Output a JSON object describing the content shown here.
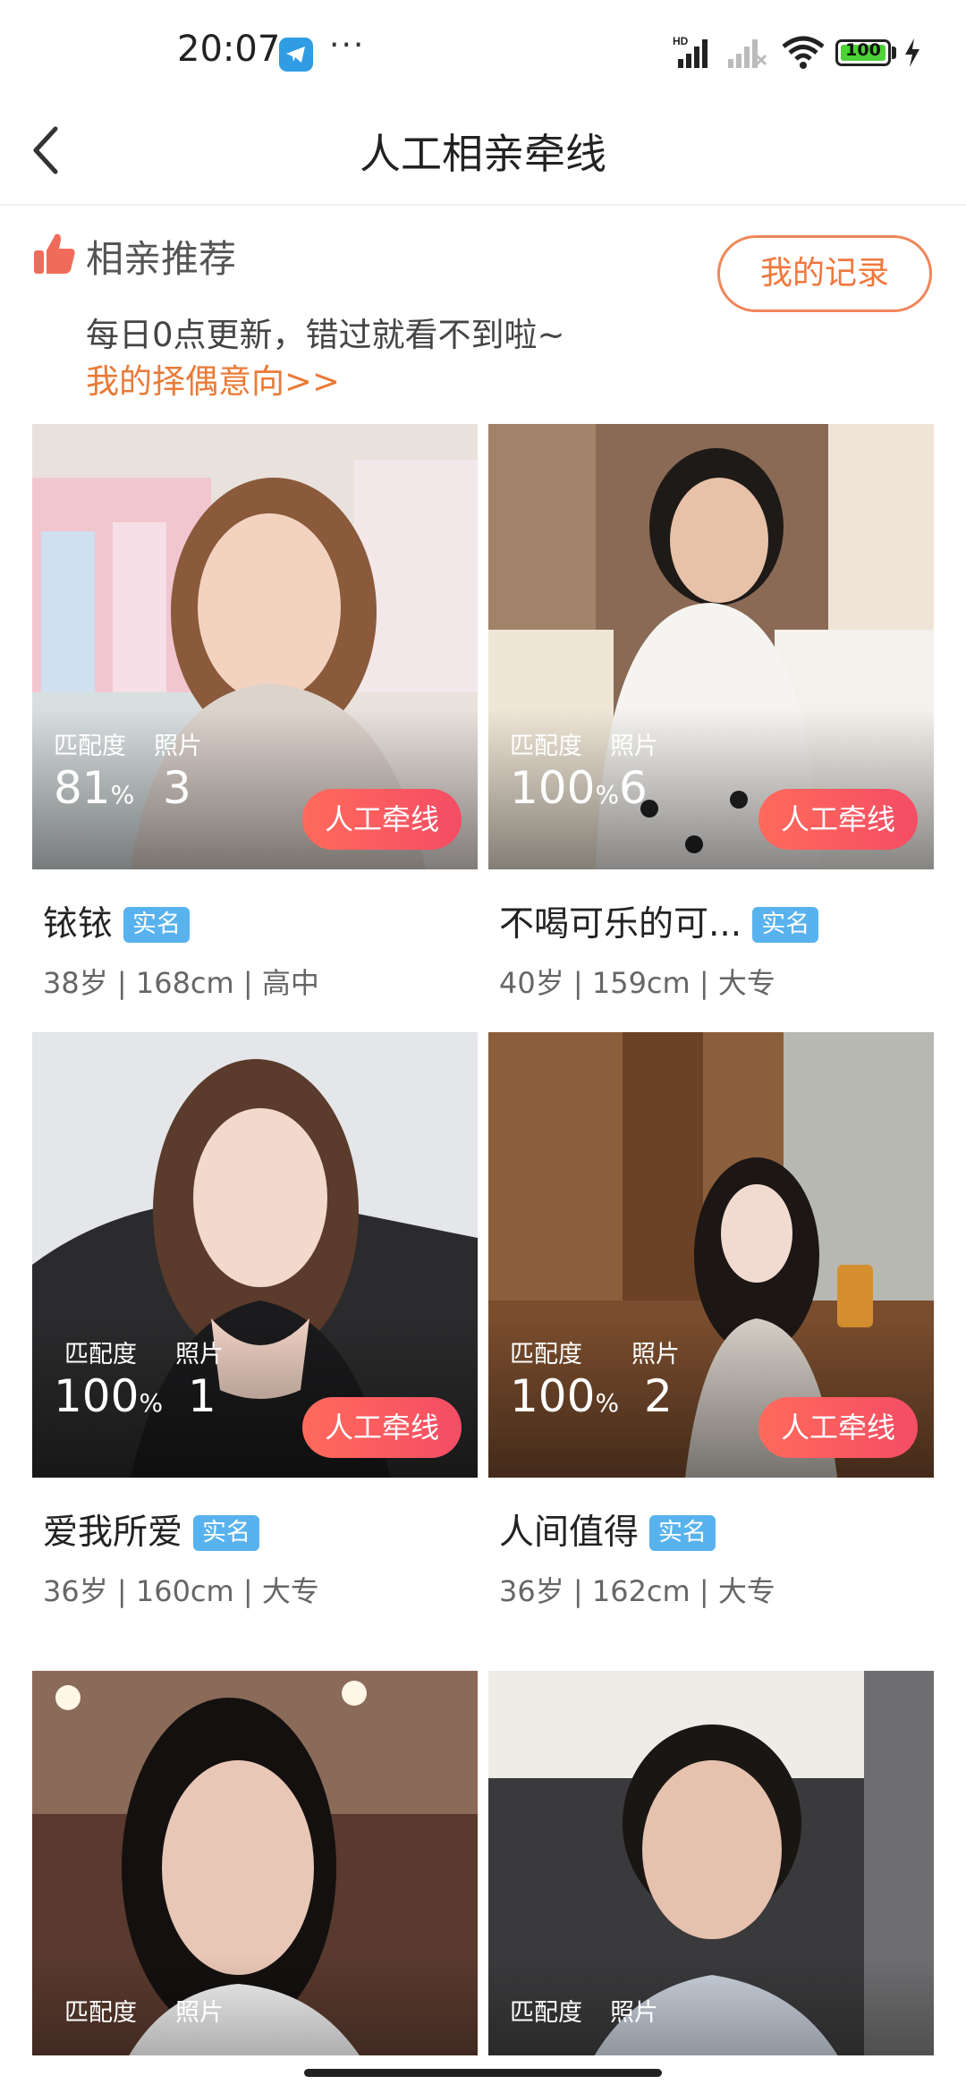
{
  "status_bar": {
    "time": "20:07",
    "battery": "100"
  },
  "nav": {
    "title": "人工相亲牵线"
  },
  "section": {
    "title": "相亲推荐",
    "subtitle": "每日0点更新，错过就看不到啦~",
    "preference_link": "我的择偶意向>>",
    "record_button": "我的记录"
  },
  "card_labels": {
    "match": "匹配度",
    "photos": "照片",
    "button": "人工牵线",
    "verified": "实名"
  },
  "cards": [
    {
      "name": "铱铱",
      "match": "81",
      "match_unit": "%",
      "photos": "3",
      "info": "38岁 | 168cm | 高中",
      "verified": true
    },
    {
      "name": "不喝可乐的可...",
      "match": "100",
      "match_unit": "%",
      "photos": "6",
      "info": "40岁 | 159cm | 大专",
      "verified": true
    },
    {
      "name": "爱我所爱",
      "match": "100",
      "match_unit": "%",
      "photos": "1",
      "info": "36岁 | 160cm | 大专",
      "verified": true
    },
    {
      "name": "人间值得",
      "match": "100",
      "match_unit": "%",
      "photos": "2",
      "info": "36岁 | 162cm | 大专",
      "verified": true
    },
    {
      "name": "",
      "match": "",
      "match_unit": "",
      "photos": "",
      "info": "",
      "verified": false
    },
    {
      "name": "",
      "match": "",
      "match_unit": "",
      "photos": "",
      "info": "",
      "verified": false
    }
  ],
  "colors": {
    "accent": "#f0773d",
    "button": "#f44d64",
    "badge": "#58b2ee"
  }
}
